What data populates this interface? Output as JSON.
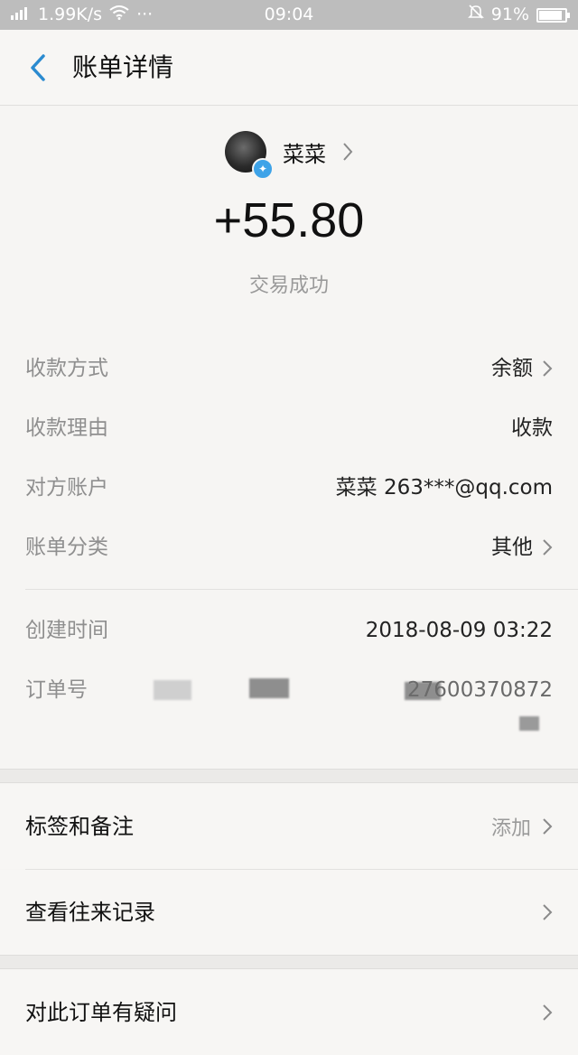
{
  "status_bar": {
    "network": "4G",
    "speed": "1.99K/s",
    "more": "···",
    "time": "09:04",
    "battery": "91%",
    "battery_level": 0.91
  },
  "header": {
    "title": "账单详情"
  },
  "summary": {
    "payee_name": "菜菜",
    "amount": "+55.80",
    "status": "交易成功"
  },
  "details": [
    {
      "label": "收款方式",
      "value": "余额",
      "chevron": true
    },
    {
      "label": "收款理由",
      "value": "收款",
      "chevron": false
    },
    {
      "label": "对方账户",
      "value": "菜菜 263***@qq.com",
      "chevron": false
    },
    {
      "label": "账单分类",
      "value": "其他",
      "chevron": true
    }
  ],
  "meta": [
    {
      "label": "创建时间",
      "value": "2018-08-09 03:22"
    },
    {
      "label": "订单号",
      "value": "27600370872"
    }
  ],
  "actions": [
    {
      "label": "标签和备注",
      "value": "添加"
    },
    {
      "label": "查看往来记录",
      "value": ""
    },
    {
      "label": "对此订单有疑问",
      "value": ""
    }
  ],
  "colors": {
    "badge": "#3ea3e8",
    "back_arrow": "#2b8bd0"
  }
}
